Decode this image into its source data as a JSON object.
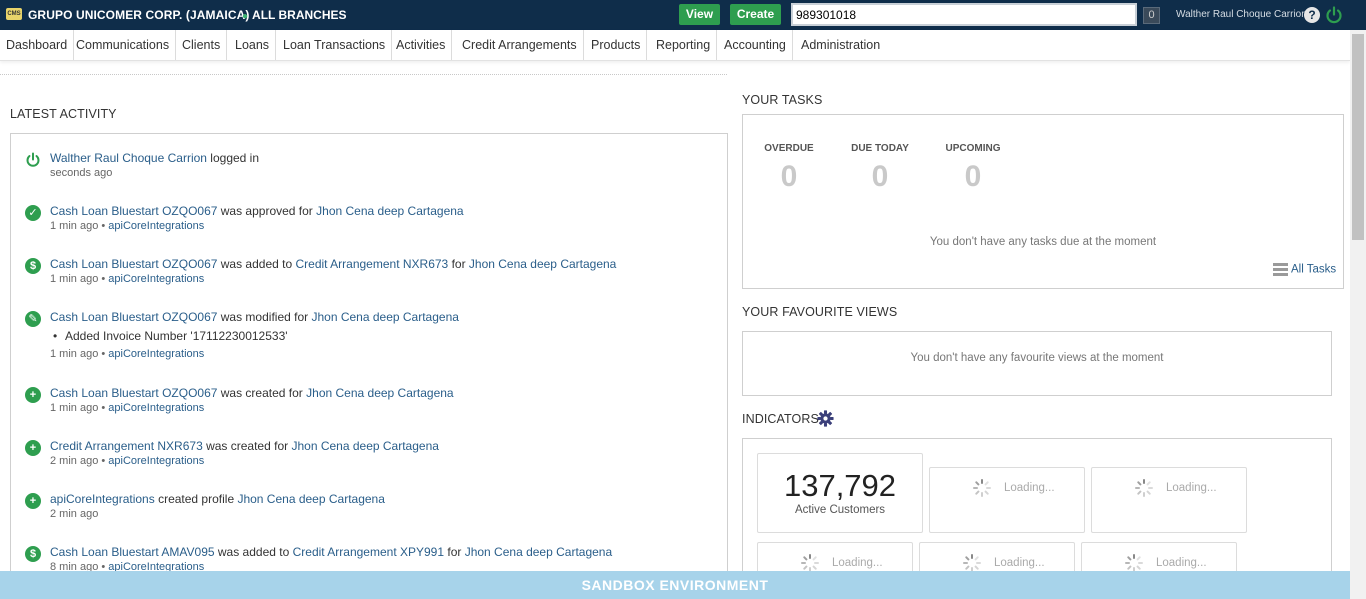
{
  "header": {
    "org_name": "GRUPO UNICOMER CORP. (JAMAICA)",
    "branch": "ALL BRANCHES",
    "view_label": "View",
    "create_label": "Create",
    "search_value": "989301018",
    "search_count": "0",
    "user_name": "Walther Raul Choque Carrion",
    "help_symbol": "?",
    "logo_text": "CMS"
  },
  "nav": {
    "items": [
      "Dashboard",
      "Communications",
      "Clients",
      "Loans",
      "Loan Transactions",
      "Activities",
      "Credit Arrangements",
      "Products",
      "Reporting",
      "Accounting",
      "Administration"
    ]
  },
  "latest_activity": {
    "title": "LATEST ACTIVITY",
    "items": [
      {
        "icon": "power-icon",
        "a": "Walther Raul Choque Carrion",
        "t1": " logged in",
        "sub": "seconds ago"
      },
      {
        "icon": "check-icon",
        "a": "Cash Loan Bluestart OZQO067",
        "t1": " was approved for ",
        "b": "Jhon Cena deep Cartagena",
        "sub": "1 min ago",
        "by": "apiCoreIntegrations"
      },
      {
        "icon": "dollar-icon",
        "a": "Cash Loan Bluestart OZQO067",
        "t1": " was added to ",
        "b": "Credit Arrangement NXR673",
        "t2": " for ",
        "c": "Jhon Cena deep Cartagena",
        "sub": "1 min ago",
        "by": "apiCoreIntegrations"
      },
      {
        "icon": "pencil-icon",
        "a": "Cash Loan Bluestart OZQO067",
        "t1": " was modified for ",
        "b": "Jhon Cena deep Cartagena",
        "detail": "Added Invoice Number '17112230012533'",
        "sub": "1 min ago",
        "by": "apiCoreIntegrations"
      },
      {
        "icon": "plus-icon",
        "a": "Cash Loan Bluestart OZQO067",
        "t1": " was created for ",
        "b": "Jhon Cena deep Cartagena",
        "sub": "1 min ago",
        "by": "apiCoreIntegrations"
      },
      {
        "icon": "plus-icon",
        "a": "Credit Arrangement NXR673",
        "t1": " was created for ",
        "b": "Jhon Cena deep Cartagena",
        "sub": "2 min ago",
        "by": "apiCoreIntegrations"
      },
      {
        "icon": "plus-icon",
        "a": "apiCoreIntegrations",
        "t1": " created profile ",
        "b": "Jhon Cena deep Cartagena",
        "sub": "2 min ago"
      },
      {
        "icon": "dollar-icon",
        "a": "Cash Loan Bluestart AMAV095",
        "t1": " was added to ",
        "b": "Credit Arrangement XPY991",
        "t2": " for ",
        "c": "Jhon Cena deep Cartagena",
        "sub": "8 min ago",
        "by": "apiCoreIntegrations"
      }
    ],
    "separator": " • "
  },
  "tasks": {
    "title": "YOUR TASKS",
    "overdue_label": "OVERDUE",
    "overdue_count": "0",
    "due_today_label": "DUE TODAY",
    "due_today_count": "0",
    "upcoming_label": "UPCOMING",
    "upcoming_count": "0",
    "empty_message": "You don't have any tasks due at the moment",
    "all_tasks_label": "All Tasks"
  },
  "favourites": {
    "title": "YOUR FAVOURITE VIEWS",
    "empty_message": "You don't have any favourite views at the moment"
  },
  "indicators": {
    "title": "INDICATORS",
    "active_customers_value": "137,792",
    "active_customers_label": "Active Customers",
    "loading_label": "Loading..."
  },
  "sandbox": {
    "label": "SANDBOX ENVIRONMENT"
  },
  "colors": {
    "header_bg": "#0f2d4a",
    "accent_green": "#2e9e4f",
    "link": "#2a5e8a",
    "sandbox_bg": "#a7d3ea"
  }
}
